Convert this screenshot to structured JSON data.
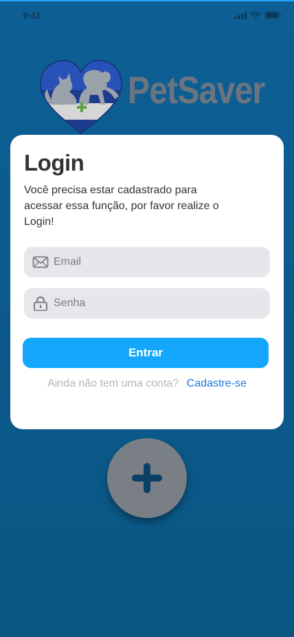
{
  "status_bar": {
    "time": "9:41"
  },
  "brand": {
    "name": "PetSaver"
  },
  "login_card": {
    "title": "Login",
    "description": "Você precisa estar cadastrado para acessar essa função, por favor realize o Login!",
    "email": {
      "placeholder": "Email",
      "value": ""
    },
    "password": {
      "placeholder": "Senha",
      "value": ""
    },
    "submit_label": "Entrar",
    "signup_prompt": "Ainda não tem uma conta?",
    "signup_link": "Cadastre-se"
  },
  "colors": {
    "background": "#0d5f95",
    "primary_button": "#14a7fc",
    "link": "#1a77d9",
    "input_background": "#e6e6eb",
    "fab": "#7a7f86"
  },
  "icons": {
    "email": "envelope-icon",
    "password": "lock-icon",
    "fab": "plus-icon"
  }
}
